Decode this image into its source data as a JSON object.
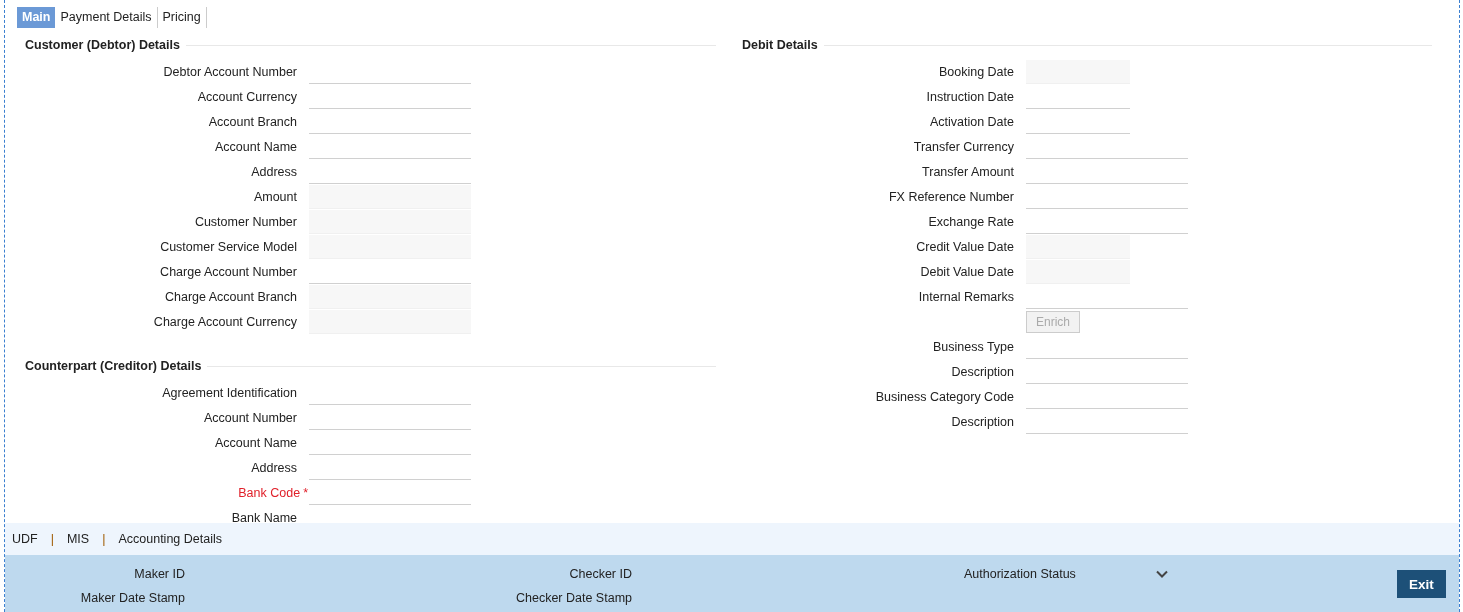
{
  "tabs": [
    {
      "label": "Main",
      "selected": true
    },
    {
      "label": "Payment Details",
      "selected": false
    },
    {
      "label": "Pricing",
      "selected": false
    }
  ],
  "columns": [
    {
      "sections": [
        {
          "title": "Customer (Debtor) Details",
          "rows": [
            {
              "label": "Debtor Account Number",
              "kind": "text"
            },
            {
              "label": "Account Currency",
              "kind": "text"
            },
            {
              "label": "Account Branch",
              "kind": "text"
            },
            {
              "label": "Account Name",
              "kind": "text"
            },
            {
              "label": "Address",
              "kind": "text"
            },
            {
              "label": "Amount",
              "kind": "readonly"
            },
            {
              "label": "Customer Number",
              "kind": "readonly"
            },
            {
              "label": "Customer Service Model",
              "kind": "readonly"
            },
            {
              "label": "Charge Account Number",
              "kind": "text"
            },
            {
              "label": "Charge Account Branch",
              "kind": "readonly"
            },
            {
              "label": "Charge Account Currency",
              "kind": "readonly"
            }
          ]
        },
        {
          "title": "Counterpart (Creditor) Details",
          "rows": [
            {
              "label": "Agreement Identification",
              "kind": "text"
            },
            {
              "label": "Account Number",
              "kind": "text"
            },
            {
              "label": "Account Name",
              "kind": "text"
            },
            {
              "label": "Address",
              "kind": "text"
            },
            {
              "label": "Bank Code",
              "kind": "text",
              "required": true,
              "required_mark": "*"
            },
            {
              "label": "Bank Name",
              "kind": "label_only"
            }
          ]
        }
      ]
    },
    {
      "sections": [
        {
          "title": "Debit Details",
          "rows": [
            {
              "label": "Booking Date",
              "kind": "readonly_short"
            },
            {
              "label": "Instruction Date",
              "kind": "text_short"
            },
            {
              "label": "Activation Date",
              "kind": "text_short"
            },
            {
              "label": "Transfer Currency",
              "kind": "text"
            },
            {
              "label": "Transfer Amount",
              "kind": "text"
            },
            {
              "label": "FX Reference Number",
              "kind": "text"
            },
            {
              "label": "Exchange Rate",
              "kind": "text"
            },
            {
              "label": "Credit Value Date",
              "kind": "readonly_short"
            },
            {
              "label": "Debit Value Date",
              "kind": "readonly_short"
            },
            {
              "label": "Internal Remarks",
              "kind": "text"
            },
            {
              "label": "Enrich",
              "kind": "button",
              "disabled": true
            },
            {
              "label": "Business Type",
              "kind": "text"
            },
            {
              "label": "Description",
              "kind": "text"
            },
            {
              "label": "Business Category Code",
              "kind": "text"
            },
            {
              "label": "Description",
              "kind": "text"
            }
          ]
        }
      ]
    }
  ],
  "footer_links": [
    {
      "kind": "link",
      "label": "UDF"
    },
    {
      "kind": "separator",
      "label": "|"
    },
    {
      "kind": "link",
      "label": "MIS"
    },
    {
      "kind": "separator",
      "label": "|"
    },
    {
      "kind": "link",
      "label": "Accounting Details"
    }
  ],
  "audit": [
    {
      "label": "Maker ID",
      "kind": "text"
    },
    {
      "label": "Checker ID",
      "kind": "text"
    },
    {
      "label": "Authorization Status",
      "kind": "dropdown"
    },
    {
      "label": "Maker Date Stamp",
      "kind": "text"
    },
    {
      "label": "Checker Date Stamp",
      "kind": "text"
    }
  ],
  "exit_button": {
    "label": "Exit"
  }
}
